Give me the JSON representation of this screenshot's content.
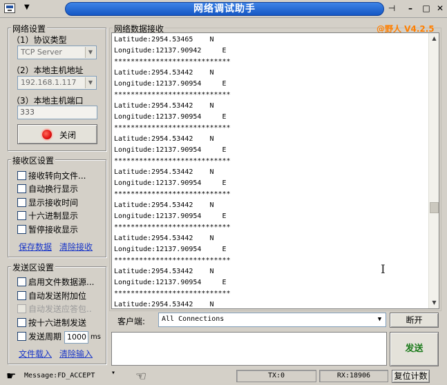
{
  "window": {
    "title": "网络调试助手"
  },
  "network_settings": {
    "title": "网络设置",
    "protocol_label": "（1）协议类型",
    "protocol_value": "TCP Server",
    "host_label": "（2）本地主机地址",
    "host_value": "192.168.1.117",
    "port_label": "（3）本地主机端口",
    "port_value": "333",
    "close_button": "关闭"
  },
  "receive_settings": {
    "title": "接收区设置",
    "options": [
      "接收转向文件...",
      "自动换行显示",
      "显示接收时间",
      "十六进制显示",
      "暂停接收显示"
    ],
    "save_link": "保存数据",
    "clear_link": "清除接收"
  },
  "send_settings": {
    "title": "发送区设置",
    "options": [
      "启用文件数据源...",
      "自动发送附加位",
      "自动发送应答包..",
      "按十六进制发送",
      "发送周期"
    ],
    "period_value": "1000",
    "period_unit": "ms",
    "load_link": "文件载入",
    "clear_link": "清除输入"
  },
  "receive_area": {
    "title": "网络数据接收",
    "watermark": "@野人 V4.2.5",
    "lines": [
      "Latitude:2954.53465    N",
      "Longitude:12137.90942     E",
      "****************************",
      "Latitude:2954.53442    N",
      "Longitude:12137.90954     E",
      "****************************",
      "Latitude:2954.53442    N",
      "Longitude:12137.90954     E",
      "****************************",
      "Latitude:2954.53442    N",
      "Longitude:12137.90954     E",
      "****************************",
      "Latitude:2954.53442    N",
      "Longitude:12137.90954     E",
      "****************************",
      "Latitude:2954.53442    N",
      "Longitude:12137.90954     E",
      "****************************",
      "Latitude:2954.53442    N",
      "Longitude:12137.90954     E",
      "****************************",
      "Latitude:2954.53442    N",
      "Longitude:12137.90954     E",
      "****************************",
      "Latitude:2954.53442    N"
    ]
  },
  "client_bar": {
    "label": "客户端:",
    "selected": "All Connections",
    "disconnect_button": "断开"
  },
  "send_button": "发送",
  "status_bar": {
    "message": "Message:FD_ACCEPT",
    "tx": "TX:0",
    "rx": "RX:18906",
    "reset_button": "复位计数"
  },
  "colors": {
    "title_bar": "#1f66d6",
    "watermark": "#ff7f00",
    "send_button_text": "#1a7a1a",
    "record_indicator": "#e01010",
    "link": "#1a37c8"
  }
}
